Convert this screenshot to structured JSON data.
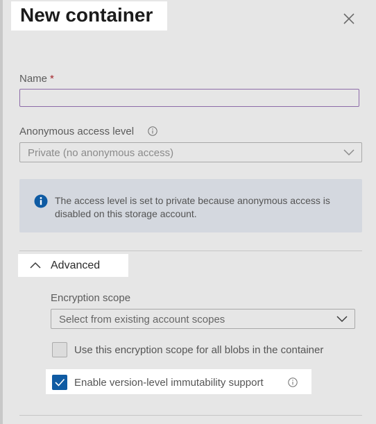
{
  "header": {
    "title": "New container",
    "close_icon": "close-icon"
  },
  "form": {
    "name": {
      "label": "Name",
      "required_mark": "*",
      "value": ""
    },
    "access_level": {
      "label": "Anonymous access level",
      "selected": "Private (no anonymous access)",
      "disabled": true
    },
    "notice": {
      "icon": "info-filled-icon",
      "text": "The access level is set to private because anonymous access is disabled on this storage account."
    },
    "advanced": {
      "label": "Advanced",
      "expanded": true,
      "encryption_scope": {
        "label": "Encryption scope",
        "selected": "Select from existing account scopes"
      },
      "use_scope_for_all": {
        "label": "Use this encryption scope for all blobs in the container",
        "checked": false,
        "disabled": true
      },
      "immutability": {
        "label": "Enable version-level immutability support",
        "checked": true
      }
    }
  },
  "colors": {
    "accent": "#0f5ba3",
    "required": "#a4262c",
    "input_focus_border": "#8c6ba8"
  }
}
